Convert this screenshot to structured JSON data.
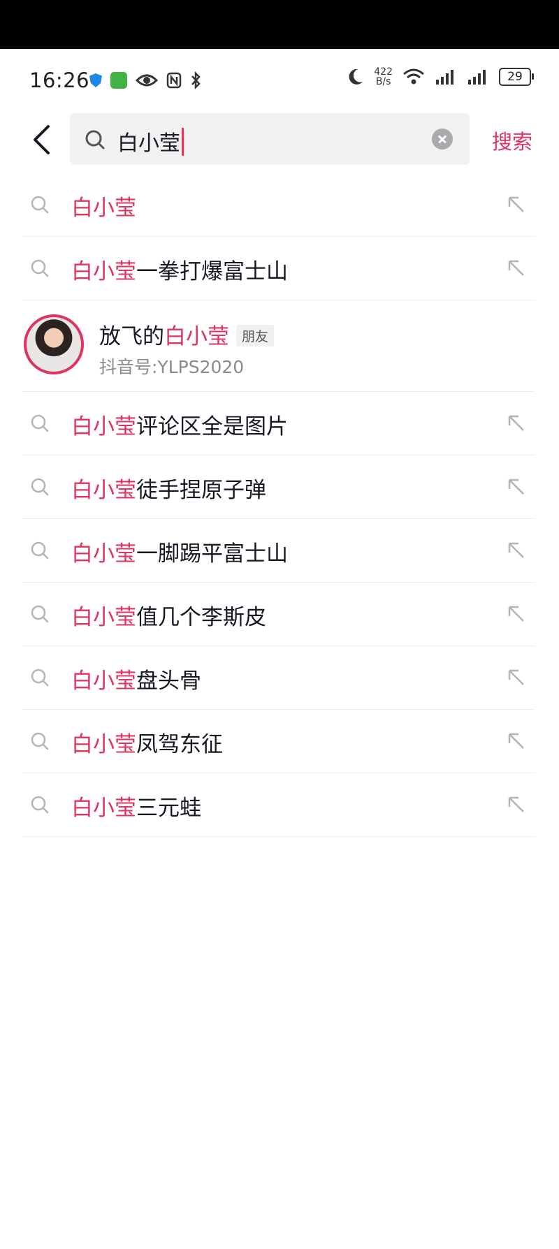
{
  "status_bar": {
    "time": "16:26",
    "net_speed_value": "422",
    "net_speed_unit": "B/s",
    "battery": "29",
    "icons": [
      "shield-icon",
      "sim-icon",
      "eye-icon",
      "nfc-icon",
      "bluetooth-icon",
      "moon-icon",
      "wifi-icon",
      "signal-icon",
      "signal-icon",
      "battery-icon"
    ]
  },
  "search": {
    "query": "白小莹",
    "button_label": "搜索"
  },
  "suggestions": [
    {
      "highlight": "白小莹",
      "rest": ""
    },
    {
      "highlight": "白小莹",
      "rest": "一拳打爆富士山"
    },
    {
      "highlight": "白小莹",
      "rest": "评论区全是图片"
    },
    {
      "highlight": "白小莹",
      "rest": "徒手捏原子弹"
    },
    {
      "highlight": "白小莹",
      "rest": "一脚踢平富士山"
    },
    {
      "highlight": "白小莹",
      "rest": "值几个李斯皮"
    },
    {
      "highlight": "白小莹",
      "rest": "盘头骨"
    },
    {
      "highlight": "白小莹",
      "rest": "凤驾东征"
    },
    {
      "highlight": "白小莹",
      "rest": "三元蛙"
    }
  ],
  "user_result": {
    "name_prefix": "放飞的",
    "name_highlight": "白小莹",
    "tag": "朋友",
    "douyin_id": "抖音号:YLPS2020"
  },
  "colors": {
    "accent": "#e0335f",
    "text": "#161823",
    "secondary_text": "#8a8b91",
    "search_bg": "#f1f1f2",
    "divider": "#ececec"
  }
}
